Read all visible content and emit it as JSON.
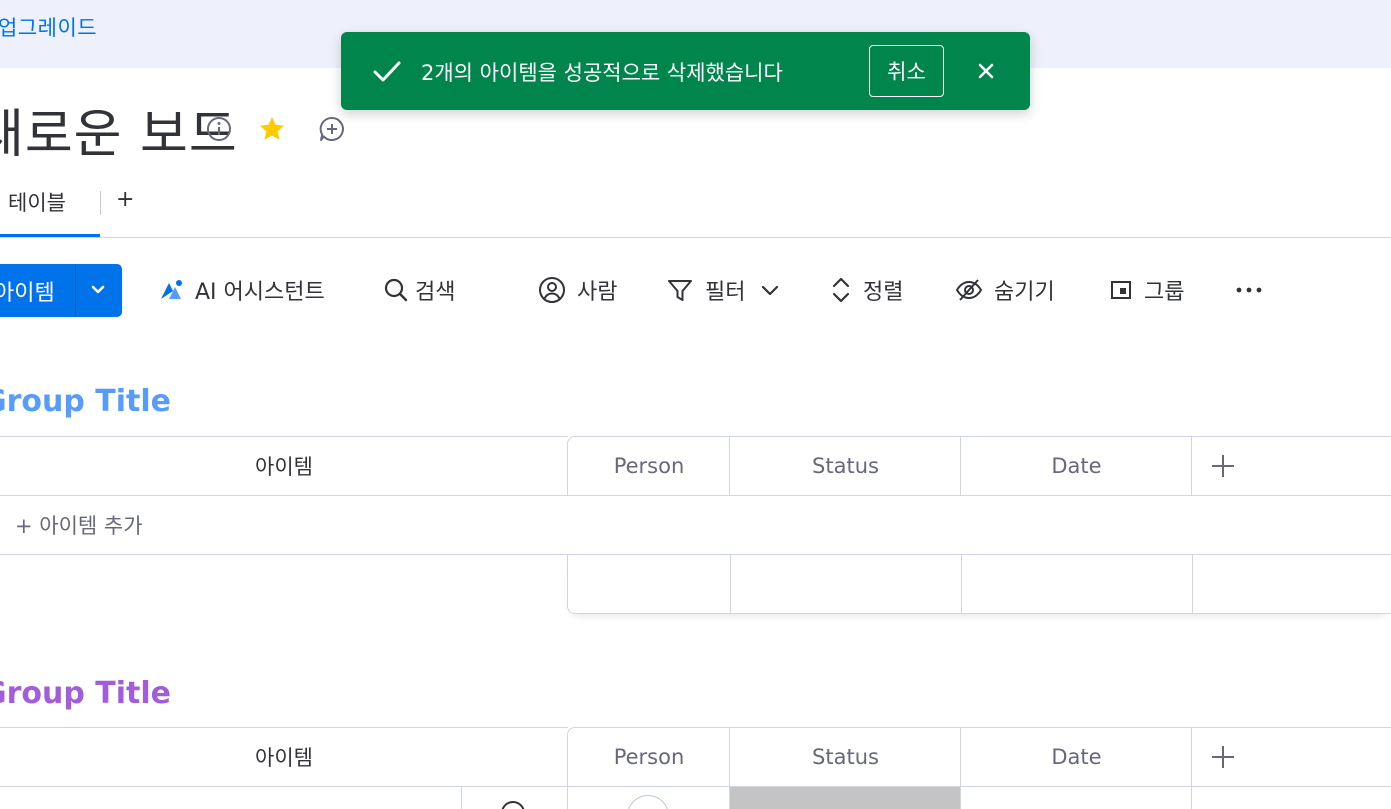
{
  "banner": {
    "upgrade": "업그레이드"
  },
  "toast": {
    "message": "2개의 아이템을 성공적으로 삭제했습니다",
    "undo": "취소",
    "bg_color": "#00854d"
  },
  "board": {
    "title": "새로운 보드"
  },
  "tabs": [
    {
      "label": "테이블",
      "active": true
    }
  ],
  "tab_add": "+",
  "toolbar": {
    "new_item": "아이템",
    "ai_assistant": "AI 어시스턴트",
    "search": "검색",
    "person": "사람",
    "filter": "필터",
    "sort": "정렬",
    "hide": "숨기기",
    "group_by": "그룹"
  },
  "groups": [
    {
      "title": "Group Title",
      "color": "#579bfc",
      "columns": [
        "아이템",
        "Person",
        "Status",
        "Date"
      ],
      "add_item": "+ 아이템 추가"
    },
    {
      "title": "Group Title",
      "color": "#a25ddc",
      "columns": [
        "아이템",
        "Person",
        "Status",
        "Date"
      ]
    }
  ]
}
